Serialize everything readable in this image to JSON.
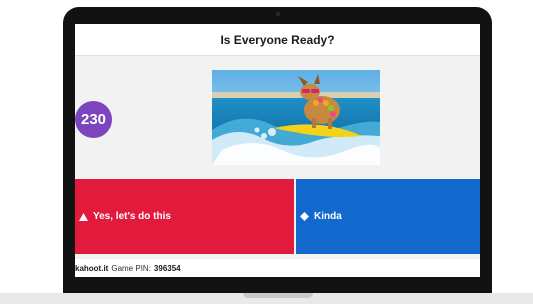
{
  "question": {
    "title": "Is Everyone Ready?"
  },
  "timer": {
    "value": "230",
    "color": "#7c45bd"
  },
  "answers": [
    {
      "label": "Yes, let's do this",
      "shape": "triangle-icon",
      "color": "#e21b3c"
    },
    {
      "label": "Kinda",
      "shape": "diamond-icon",
      "color": "#1368ce"
    }
  ],
  "footer": {
    "brand": "kahoot.it",
    "pin_label": "Game PIN:",
    "pin_value": "396354"
  }
}
